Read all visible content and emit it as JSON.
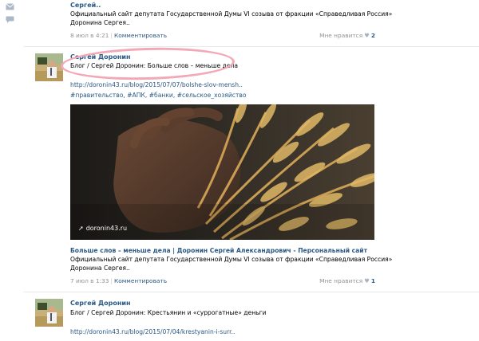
{
  "rail": {
    "mail_icon": "mail-icon",
    "chat_icon": "chat-icon"
  },
  "post0": {
    "author": "Сергей..",
    "line1": "Официальный сайт депутата Государственной Думы VI созыва от фракции «Справедливая Россия»",
    "line2": "Доронина Сергея..",
    "date": "8 июл в 4:21",
    "comment_label": "Комментировать",
    "like_label": "Мне нравится",
    "like_count": "2"
  },
  "post1": {
    "author": "Сергей Доронин",
    "text": "Блог / Сергей Доронин: Больше слов – меньше дела",
    "url": "http://doronin43.ru/blog/2015/07/07/bolshe-slov-mensh..",
    "tags": "#правительство, #АПК, #банки, #сельское_хозяйство",
    "watermark": "doronin43.ru",
    "link_title": "Больше слов – меньше дела | Доронин Сергей Александрович - Персональный сайт",
    "link_line1": "Официальный сайт депутата Государственной Думы VI созыва от фракции «Справедливая Россия»",
    "link_line2": "Доронина Сергея..",
    "date": "7 июл в 1:33",
    "comment_label": "Комментировать",
    "like_label": "Мне нравится",
    "like_count": "1"
  },
  "post2": {
    "author": "Сергей Доронин",
    "text": "Блог / Сергей Доронин: Крестьянин и «суррогатные» деньги",
    "url": "http://doronin43.ru/blog/2015/07/04/krestyanin-i-surr.."
  },
  "colors": {
    "link": "#2a5885",
    "meta": "#939393",
    "highlight_oval": "#f2a9b6"
  }
}
